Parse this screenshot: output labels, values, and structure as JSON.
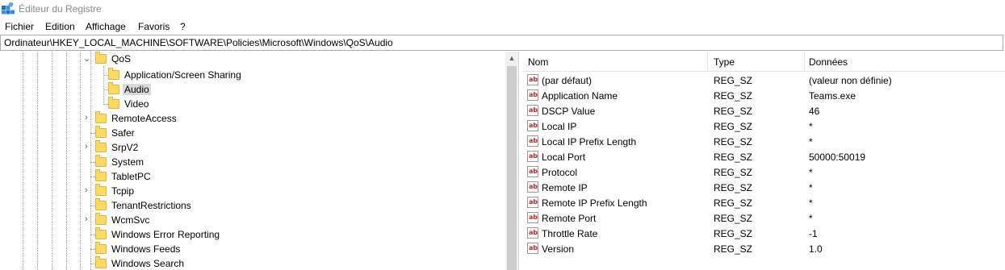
{
  "window": {
    "title": "Éditeur du Registre",
    "icon": "registry-editor-icon"
  },
  "menu": [
    "Fichier",
    "Edition",
    "Affichage",
    "Favoris",
    "?"
  ],
  "address": "Ordinateur\\HKEY_LOCAL_MACHINE\\SOFTWARE\\Policies\\Microsoft\\Windows\\QoS\\Audio",
  "tree": {
    "items": [
      {
        "label": "QoS",
        "expander": "expanded"
      },
      {
        "label": "Application/Screen Sharing",
        "expander": "none"
      },
      {
        "label": "Audio",
        "expander": "none",
        "selected": true
      },
      {
        "label": "Video",
        "expander": "none"
      },
      {
        "label": "RemoteAccess",
        "expander": "collapsed"
      },
      {
        "label": "Safer",
        "expander": "none"
      },
      {
        "label": "SrpV2",
        "expander": "collapsed"
      },
      {
        "label": "System",
        "expander": "none"
      },
      {
        "label": "TabletPC",
        "expander": "none"
      },
      {
        "label": "Tcpip",
        "expander": "collapsed"
      },
      {
        "label": "TenantRestrictions",
        "expander": "none"
      },
      {
        "label": "WcmSvc",
        "expander": "collapsed"
      },
      {
        "label": "Windows Error Reporting",
        "expander": "none"
      },
      {
        "label": "Windows Feeds",
        "expander": "none"
      },
      {
        "label": "Windows Search",
        "expander": "none"
      }
    ]
  },
  "list": {
    "columns": [
      "Nom",
      "Type",
      "Données"
    ],
    "value_icon": "string-value-icon",
    "value_icon_text": "ab",
    "rows": [
      {
        "name": "(par défaut)",
        "type": "REG_SZ",
        "data": "(valeur non définie)"
      },
      {
        "name": "Application Name",
        "type": "REG_SZ",
        "data": "Teams.exe"
      },
      {
        "name": "DSCP Value",
        "type": "REG_SZ",
        "data": "46"
      },
      {
        "name": "Local IP",
        "type": "REG_SZ",
        "data": "*"
      },
      {
        "name": "Local IP Prefix Length",
        "type": "REG_SZ",
        "data": "*"
      },
      {
        "name": "Local Port",
        "type": "REG_SZ",
        "data": "50000:50019"
      },
      {
        "name": "Protocol",
        "type": "REG_SZ",
        "data": "*"
      },
      {
        "name": "Remote IP",
        "type": "REG_SZ",
        "data": "*"
      },
      {
        "name": "Remote IP Prefix Length",
        "type": "REG_SZ",
        "data": "*"
      },
      {
        "name": "Remote Port",
        "type": "REG_SZ",
        "data": "*"
      },
      {
        "name": "Throttle Rate",
        "type": "REG_SZ",
        "data": "-1"
      },
      {
        "name": "Version",
        "type": "REG_SZ",
        "data": "1.0"
      }
    ]
  },
  "colors": {
    "selection": "#d9d9d9",
    "folder": "#ffd966",
    "folder_border": "#e0b73c",
    "title_text": "#8a8a8a",
    "ab_text": "#c0282b"
  }
}
